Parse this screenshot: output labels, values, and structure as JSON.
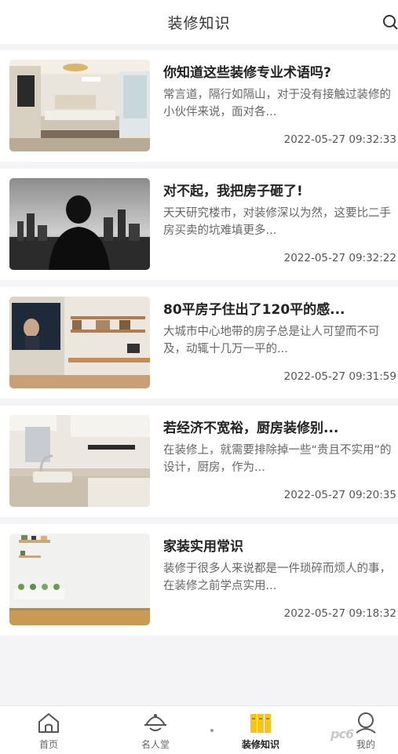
{
  "header": {
    "title": "装修知识"
  },
  "articles": [
    {
      "title": "你知道这些装修专业术语吗?",
      "summary": "常言道，隔行如隔山，对于没有接触过装修的小伙伴来说，面对各...",
      "date": "2022-05-27 09:32:33"
    },
    {
      "title": "对不起，我把房子砸了!",
      "summary": "天天研究楼市，对装修深以为然，这要比二手房买卖的坑难填更多...",
      "date": "2022-05-27 09:32:22"
    },
    {
      "title": "80平房子住出了120平的感...",
      "summary": "大城市中心地带的房子总是让人可望而不可及，动辄十几万一平的...",
      "date": "2022-05-27 09:31:59"
    },
    {
      "title": "若经济不宽裕，厨房装修别...",
      "summary": "在装修上，就需要排除掉一些“贵且不实用”的设计，厨房，作为...",
      "date": "2022-05-27 09:20:35"
    },
    {
      "title": "家装实用常识",
      "summary": "装修于很多人来说都是一件琐碎而烦人的事，在装修之前学点实用...",
      "date": "2022-05-27 09:18:32"
    }
  ],
  "tabs": [
    {
      "label": "首页",
      "icon": "home-icon"
    },
    {
      "label": "名人堂",
      "icon": "hall-icon"
    },
    {
      "label": "装修知识",
      "icon": "books-icon"
    },
    {
      "label": "我的",
      "icon": "profile-icon"
    }
  ],
  "colors": {
    "accent": "#f5c518",
    "background": "#f4f4f6"
  },
  "watermark": "pc6"
}
